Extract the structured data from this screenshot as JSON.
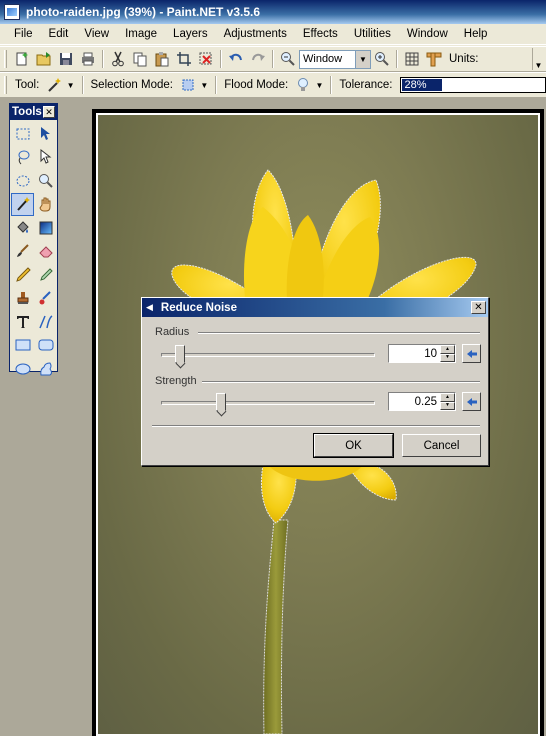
{
  "window": {
    "title": "photo-raiden.jpg (39%) - Paint.NET v3.5.6"
  },
  "menu": [
    "File",
    "Edit",
    "View",
    "Image",
    "Layers",
    "Adjustments",
    "Effects",
    "Utilities",
    "Window",
    "Help"
  ],
  "toolbar": {
    "zoom_value": "Window",
    "units_label": "Units:",
    "tool_label": "Tool:",
    "selection_mode_label": "Selection Mode:",
    "flood_mode_label": "Flood Mode:",
    "tolerance_label": "Tolerance:",
    "tolerance_value": "28%",
    "tolerance_fraction": 0.28
  },
  "tools_window": {
    "title": "Tools",
    "close": "✕",
    "active_tool": "magic-wand-tool"
  },
  "dialog": {
    "title": "Reduce Noise",
    "close": "✕",
    "radius": {
      "label": "Radius",
      "value": "10",
      "slider_fraction": 0.07
    },
    "strength": {
      "label": "Strength",
      "value": "0.25",
      "slider_fraction": 0.27
    },
    "ok_label": "OK",
    "cancel_label": "Cancel"
  },
  "colors": {
    "titlebar": "#0a246a",
    "flower": "#f2d020",
    "background": "#7d7b52",
    "stem": "#8a8a30"
  }
}
